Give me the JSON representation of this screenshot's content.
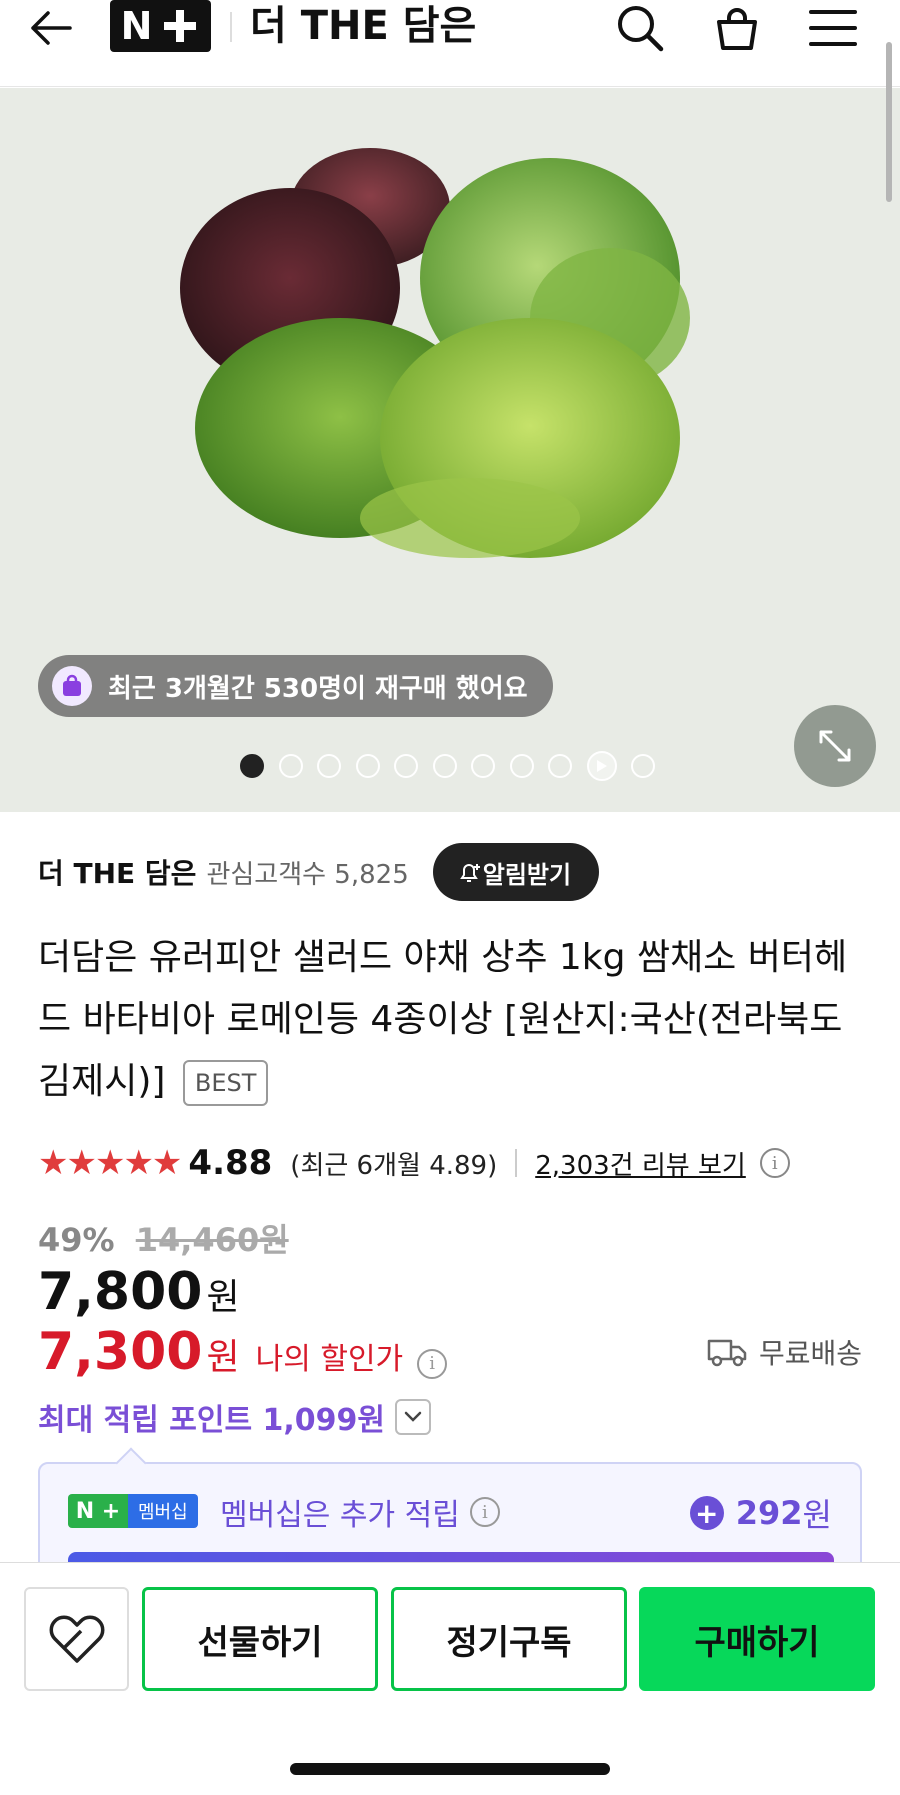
{
  "header": {
    "logo_text": "N+",
    "store_name": "더 THE 담은",
    "icons": [
      "back-arrow-icon",
      "search-icon",
      "shopping-bag-icon",
      "menu-icon"
    ]
  },
  "gallery": {
    "repurchase_text": "최근 3개월간 530명이 재구매 했어요",
    "total_dots": 11,
    "active_dot": 0,
    "video_dot": 9
  },
  "store": {
    "name": "더 THE 담은",
    "fans_label": "관심고객수 5,825",
    "alarm_label": "알림받기"
  },
  "product": {
    "title": "더담은 유러피안 샐러드 야채 상추 1kg 쌈채소 버터헤드 바타비아 로메인등 4종이상 [원산지:국산(전라북도 김제시)]",
    "badge": "BEST"
  },
  "rating": {
    "stars": "★★★★★",
    "score": "4.88",
    "recent": "(최근 6개월 4.89)",
    "reviews_link": "2,303건 리뷰 보기"
  },
  "price": {
    "discount": "49%",
    "original": "14,460원",
    "sale": "7,800",
    "currency": "원",
    "my_price": "7,300",
    "my_price_label": "나의 할인가",
    "shipping": "무료배송",
    "points": "최대 적립 포인트 1,099원"
  },
  "membership": {
    "badge_n": "N +",
    "badge_text": "멤버십",
    "text": "멤버십은 추가 적립",
    "points": "292",
    "points_unit": "원"
  },
  "actions": {
    "gift": "선물하기",
    "subscribe": "정기구독",
    "buy": "구매하기"
  },
  "colors": {
    "accent_green": "#07d85a",
    "price_red": "#d71a2a",
    "points_purple": "#7a4fd6",
    "star_red": "#e03c3c"
  }
}
